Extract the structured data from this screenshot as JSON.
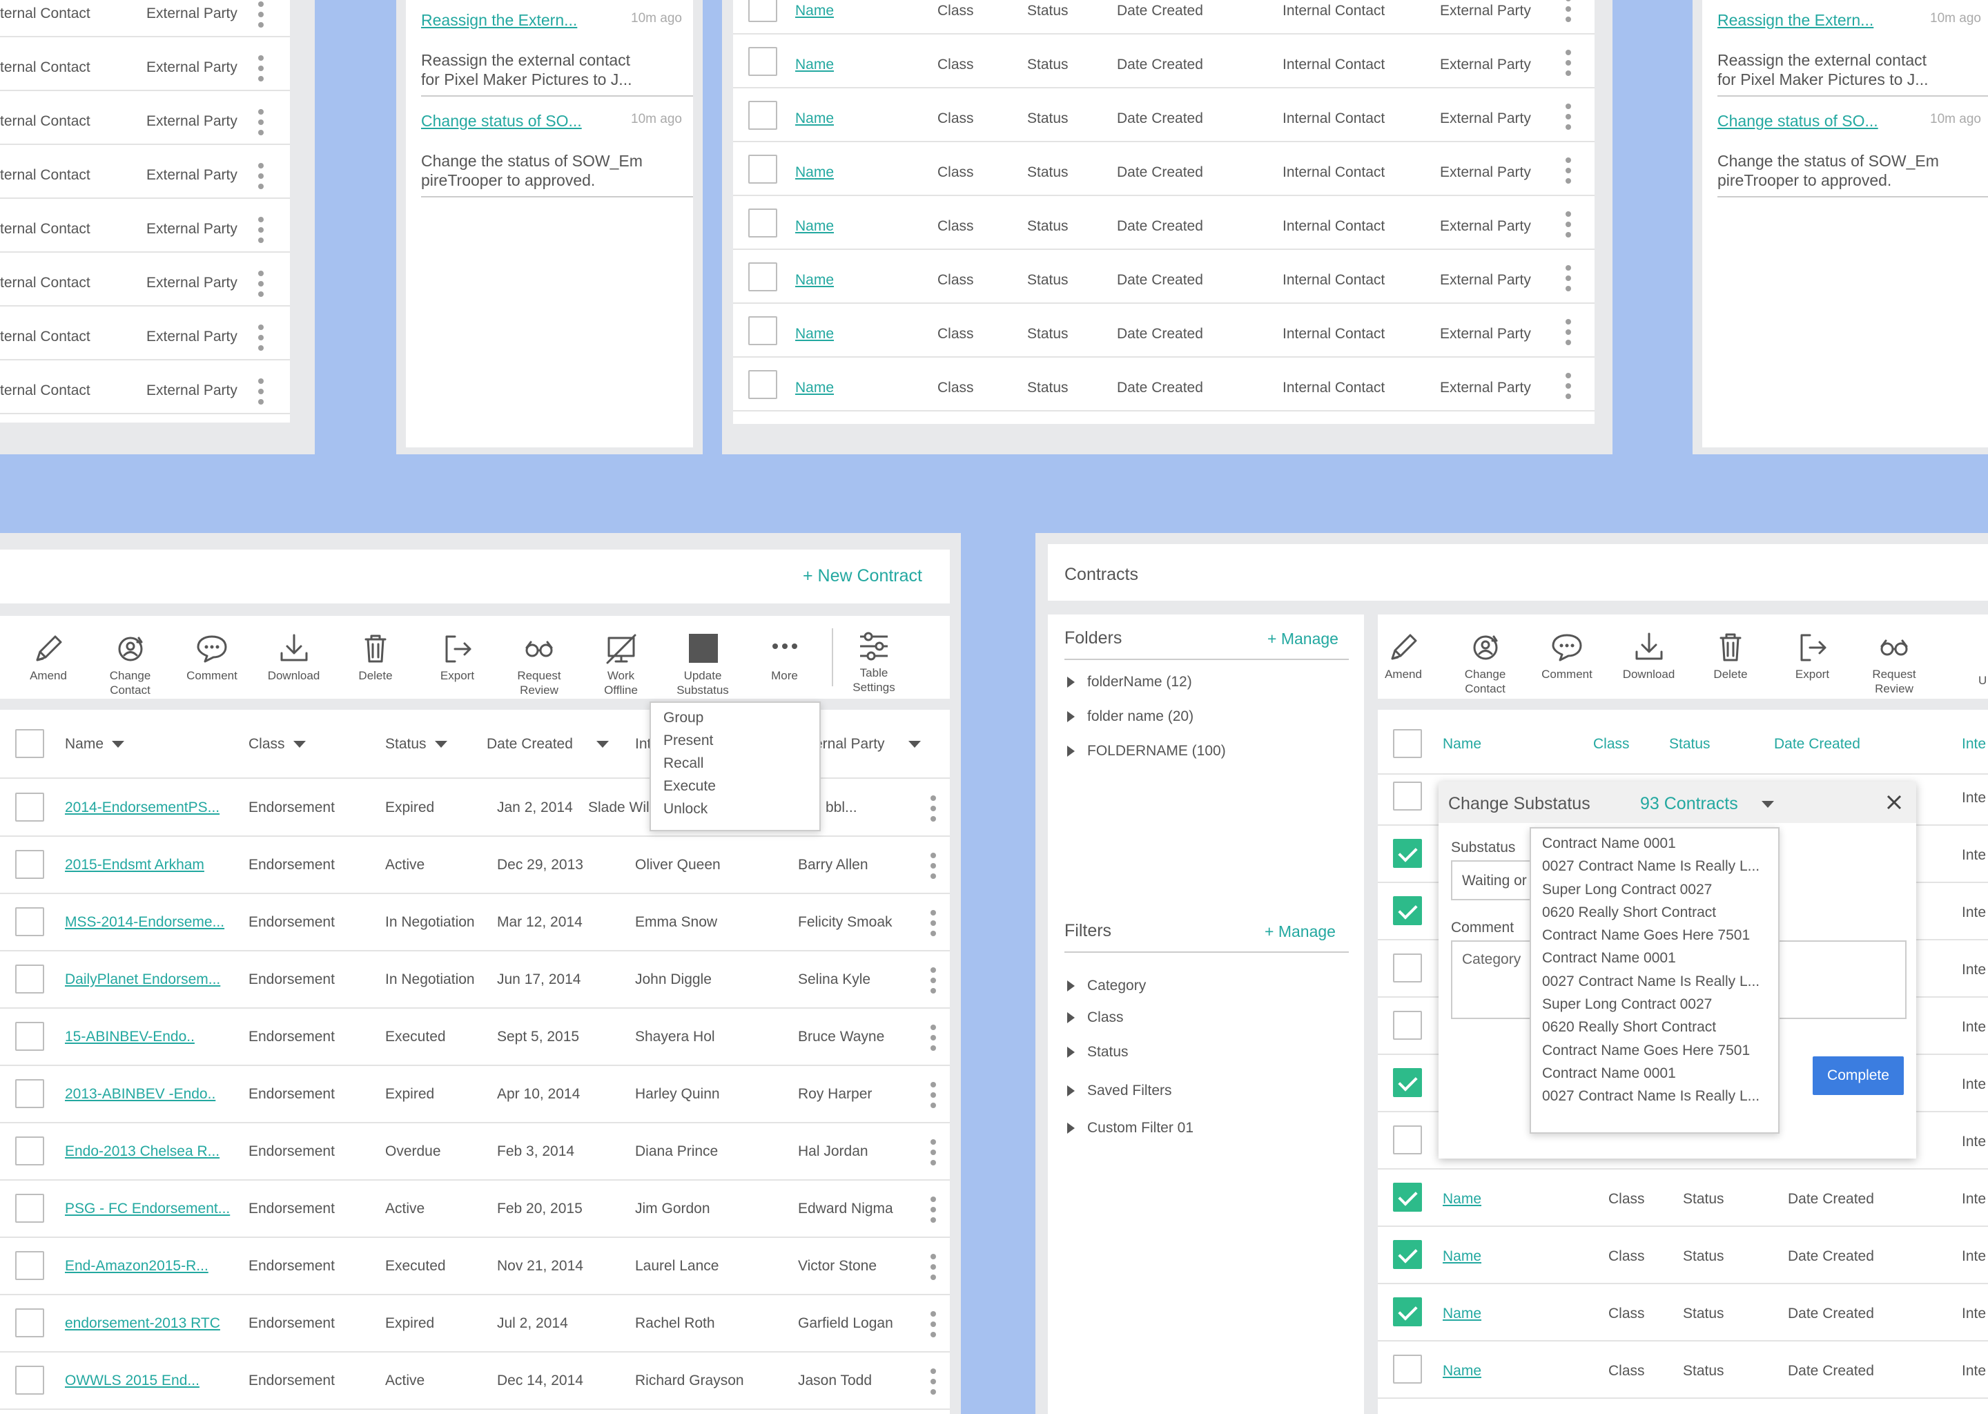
{
  "tl_list": {
    "rows": [
      {
        "contact": "ternal Contact",
        "party": "External Party"
      },
      {
        "contact": "ternal Contact",
        "party": "External Party"
      },
      {
        "contact": "ternal Contact",
        "party": "External Party"
      },
      {
        "contact": "ternal Contact",
        "party": "External Party"
      },
      {
        "contact": "ternal Contact",
        "party": "External Party"
      },
      {
        "contact": "ternal Contact",
        "party": "External Party"
      },
      {
        "contact": "ternal Contact",
        "party": "External Party"
      },
      {
        "contact": "ternal Contact",
        "party": "External Party"
      }
    ]
  },
  "activity": {
    "items": [
      {
        "title": "Reassign the Extern...",
        "time": "10m ago",
        "desc1": "Reassign the external contact",
        "desc2": "for Pixel Maker Pictures to J..."
      },
      {
        "title": "Change status of SO...",
        "time": "10m ago",
        "desc1": "Change the status of SOW_Em",
        "desc2": "pireTrooper to approved."
      }
    ]
  },
  "top_table": {
    "rows": [
      {
        "name": "Name",
        "class": "Class",
        "status": "Status",
        "date": "Date Created",
        "internal": "Internal Contact",
        "external": "External Party"
      },
      {
        "name": "Name",
        "class": "Class",
        "status": "Status",
        "date": "Date Created",
        "internal": "Internal Contact",
        "external": "External Party"
      },
      {
        "name": "Name",
        "class": "Class",
        "status": "Status",
        "date": "Date Created",
        "internal": "Internal Contact",
        "external": "External Party"
      },
      {
        "name": "Name",
        "class": "Class",
        "status": "Status",
        "date": "Date Created",
        "internal": "Internal Contact",
        "external": "External Party"
      },
      {
        "name": "Name",
        "class": "Class",
        "status": "Status",
        "date": "Date Created",
        "internal": "Internal Contact",
        "external": "External Party"
      },
      {
        "name": "Name",
        "class": "Class",
        "status": "Status",
        "date": "Date Created",
        "internal": "Internal Contact",
        "external": "External Party"
      },
      {
        "name": "Name",
        "class": "Class",
        "status": "Status",
        "date": "Date Created",
        "internal": "Internal Contact",
        "external": "External Party"
      },
      {
        "name": "Name",
        "class": "Class",
        "status": "Status",
        "date": "Date Created",
        "internal": "Internal Contact",
        "external": "External Party"
      }
    ]
  },
  "left_app": {
    "new_contract": "+ New Contract",
    "toolbar": [
      {
        "icon": "pencil-icon",
        "l1": "Amend",
        "l2": ""
      },
      {
        "icon": "change-contact-icon",
        "l1": "Change",
        "l2": "Contact"
      },
      {
        "icon": "comment-icon",
        "l1": "Comment",
        "l2": ""
      },
      {
        "icon": "download-icon",
        "l1": "Download",
        "l2": ""
      },
      {
        "icon": "trash-icon",
        "l1": "Delete",
        "l2": ""
      },
      {
        "icon": "export-icon",
        "l1": "Export",
        "l2": ""
      },
      {
        "icon": "glasses-icon",
        "l1": "Request",
        "l2": "Review"
      },
      {
        "icon": "offline-monitor-icon",
        "l1": "Work",
        "l2": "Offline"
      },
      {
        "icon": "square-icon",
        "l1": "Update",
        "l2": "Substatus"
      },
      {
        "icon": "more-dots-icon",
        "l1": "More",
        "l2": ""
      }
    ],
    "table_settings": {
      "l1": "Table",
      "l2": "Settings"
    },
    "columns": {
      "name": "Name",
      "class": "Class",
      "status": "Status",
      "date": "Date Created",
      "internal": "Int",
      "external": "ernal Party"
    },
    "more_menu": [
      "Group",
      "Present",
      "Recall",
      "Execute",
      "Unlock"
    ],
    "rows": [
      {
        "name": "2014-EndorsementPS...",
        "class": "Endorsement",
        "status": "Expired",
        "date": "Jan 2, 2014",
        "internal": "Slade Wils",
        "external": "bbl..."
      },
      {
        "name": "2015-Endsmt Arkham",
        "class": "Endorsement",
        "status": "Active",
        "date": "Dec 29, 2013",
        "internal": "Oliver Queen",
        "external": "Barry Allen"
      },
      {
        "name": "MSS-2014-Endorseme...",
        "class": "Endorsement",
        "status": "In Negotiation",
        "date": "Mar 12, 2014",
        "internal": "Emma Snow",
        "external": "Felicity Smoak"
      },
      {
        "name": "DailyPlanet Endorsem...",
        "class": "Endorsement",
        "status": "In Negotiation",
        "date": "Jun 17, 2014",
        "internal": "John Diggle",
        "external": "Selina Kyle"
      },
      {
        "name": "15-ABINBEV-Endo..",
        "class": "Endorsement",
        "status": "Executed",
        "date": "Sept 5, 2015",
        "internal": "Shayera Hol",
        "external": "Bruce Wayne"
      },
      {
        "name": "2013-ABINBEV -Endo..",
        "class": "Endorsement",
        "status": "Expired",
        "date": "Apr 10, 2014",
        "internal": "Harley Quinn",
        "external": "Roy Harper"
      },
      {
        "name": "Endo-2013 Chelsea R...",
        "class": "Endorsement",
        "status": "Overdue",
        "date": "Feb 3, 2014",
        "internal": "Diana Prince",
        "external": "Hal Jordan"
      },
      {
        "name": "PSG - FC Endorsement...",
        "class": "Endorsement",
        "status": "Active",
        "date": "Feb 20, 2015",
        "internal": "Jim Gordon",
        "external": "Edward Nigma"
      },
      {
        "name": "End-Amazon2015-R...",
        "class": "Endorsement",
        "status": "Executed",
        "date": "Nov 21, 2014",
        "internal": "Laurel Lance",
        "external": "Victor Stone"
      },
      {
        "name": "endorsement-2013 RTC",
        "class": "Endorsement",
        "status": "Expired",
        "date": "Jul 2, 2014",
        "internal": "Rachel Roth",
        "external": "Garfield Logan"
      },
      {
        "name": "OWWLS 2015 End...",
        "class": "Endorsement",
        "status": "Active",
        "date": "Dec 14, 2014",
        "internal": "Richard Grayson",
        "external": "Jason Todd"
      }
    ]
  },
  "right_app": {
    "title": "Contracts",
    "folders": {
      "heading": "Folders",
      "manage": "+ Manage",
      "items": [
        "folderName (12)",
        "folder name (20)",
        "FOLDERNAME (100)"
      ]
    },
    "filters": {
      "heading": "Filters",
      "manage": "+ Manage",
      "items": [
        "Category",
        "Class",
        "Status",
        "Saved Filters",
        "Custom Filter 01"
      ]
    },
    "toolbar": [
      {
        "icon": "pencil-icon",
        "l1": "Amend",
        "l2": ""
      },
      {
        "icon": "change-contact-icon",
        "l1": "Change",
        "l2": "Contact"
      },
      {
        "icon": "comment-icon",
        "l1": "Comment",
        "l2": ""
      },
      {
        "icon": "download-icon",
        "l1": "Download",
        "l2": ""
      },
      {
        "icon": "trash-icon",
        "l1": "Delete",
        "l2": ""
      },
      {
        "icon": "export-icon",
        "l1": "Export",
        "l2": ""
      },
      {
        "icon": "glasses-icon",
        "l1": "Request",
        "l2": "Review"
      }
    ],
    "toolbar_partial": "U",
    "columns": {
      "name": "Name",
      "class": "Class",
      "status": "Status",
      "date": "Date Created",
      "inte": "Inte"
    },
    "row_checks": [
      false,
      false,
      true,
      true,
      false,
      false,
      true,
      false,
      true,
      true,
      true,
      false
    ],
    "bottom_rows": [
      {
        "name": "Name",
        "class": "Class",
        "status": "Status",
        "date": "Date Created",
        "inte": "Inte"
      },
      {
        "name": "Name",
        "class": "Class",
        "status": "Status",
        "date": "Date Created",
        "inte": "Inte"
      },
      {
        "name": "Name",
        "class": "Class",
        "status": "Status",
        "date": "Date Created",
        "inte": "Inte"
      },
      {
        "name": "Name",
        "class": "Class",
        "status": "Status",
        "date": "Date Created",
        "inte": "Inte"
      }
    ],
    "modal": {
      "title": "Change Substatus",
      "count": "93 Contracts",
      "substatus_label": "Substatus",
      "substatus_value": "Waiting or",
      "comment_label": "Comment",
      "comment_placeholder": "Category",
      "complete": "Complete",
      "contracts": [
        "Contract Name 0001",
        "0027 Contract Name Is Really L...",
        "Super Long Contract 0027",
        "0620 Really Short Contract",
        "Contract Name Goes Here 7501",
        "Contract Name 0001",
        "0027 Contract Name Is Really L...",
        "Super Long Contract 0027",
        "0620 Really Short Contract",
        "Contract Name Goes Here 7501",
        "Contract Name 0001",
        "0027 Contract Name Is Really L..."
      ]
    }
  }
}
